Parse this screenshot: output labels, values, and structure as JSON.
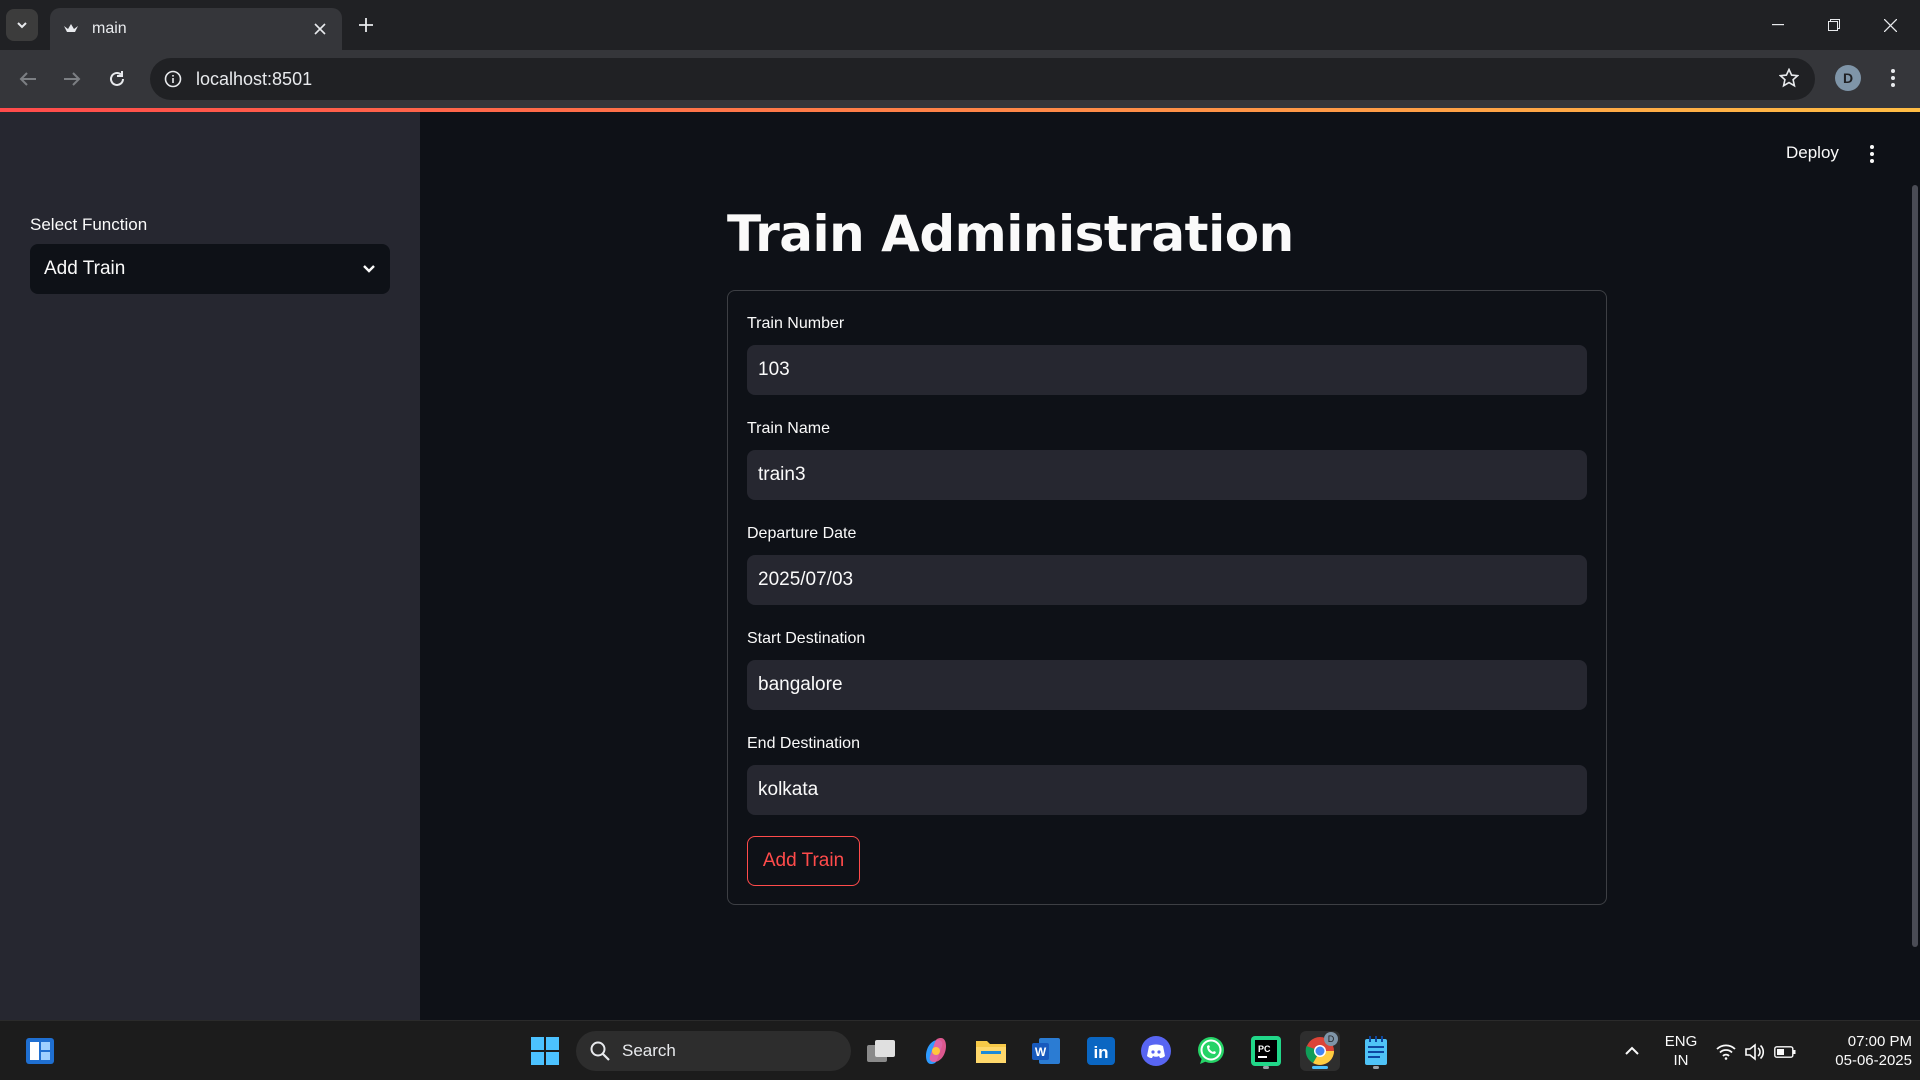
{
  "browser": {
    "tab_title": "main",
    "url": "localhost:8501",
    "profile_initial": "D"
  },
  "sidebar": {
    "select_label": "Select Function",
    "select_value": "Add Train"
  },
  "header": {
    "deploy_label": "Deploy"
  },
  "main": {
    "title": "Train Administration",
    "form": {
      "fields": [
        {
          "label": "Train Number",
          "value": "103"
        },
        {
          "label": "Train Name",
          "value": "train3"
        },
        {
          "label": "Departure Date",
          "value": "2025/07/03"
        },
        {
          "label": "Start Destination",
          "value": "bangalore"
        },
        {
          "label": "End Destination",
          "value": "kolkata"
        }
      ],
      "submit_label": "Add Train"
    }
  },
  "taskbar": {
    "search_label": "Search",
    "language": "ENG",
    "region": "IN",
    "time": "07:00 PM",
    "date": "05-06-2025",
    "chrome_badge": "D"
  },
  "colors": {
    "accent": "#ff4b4b",
    "sidebar_bg": "#262730",
    "main_bg": "#0e1117"
  }
}
